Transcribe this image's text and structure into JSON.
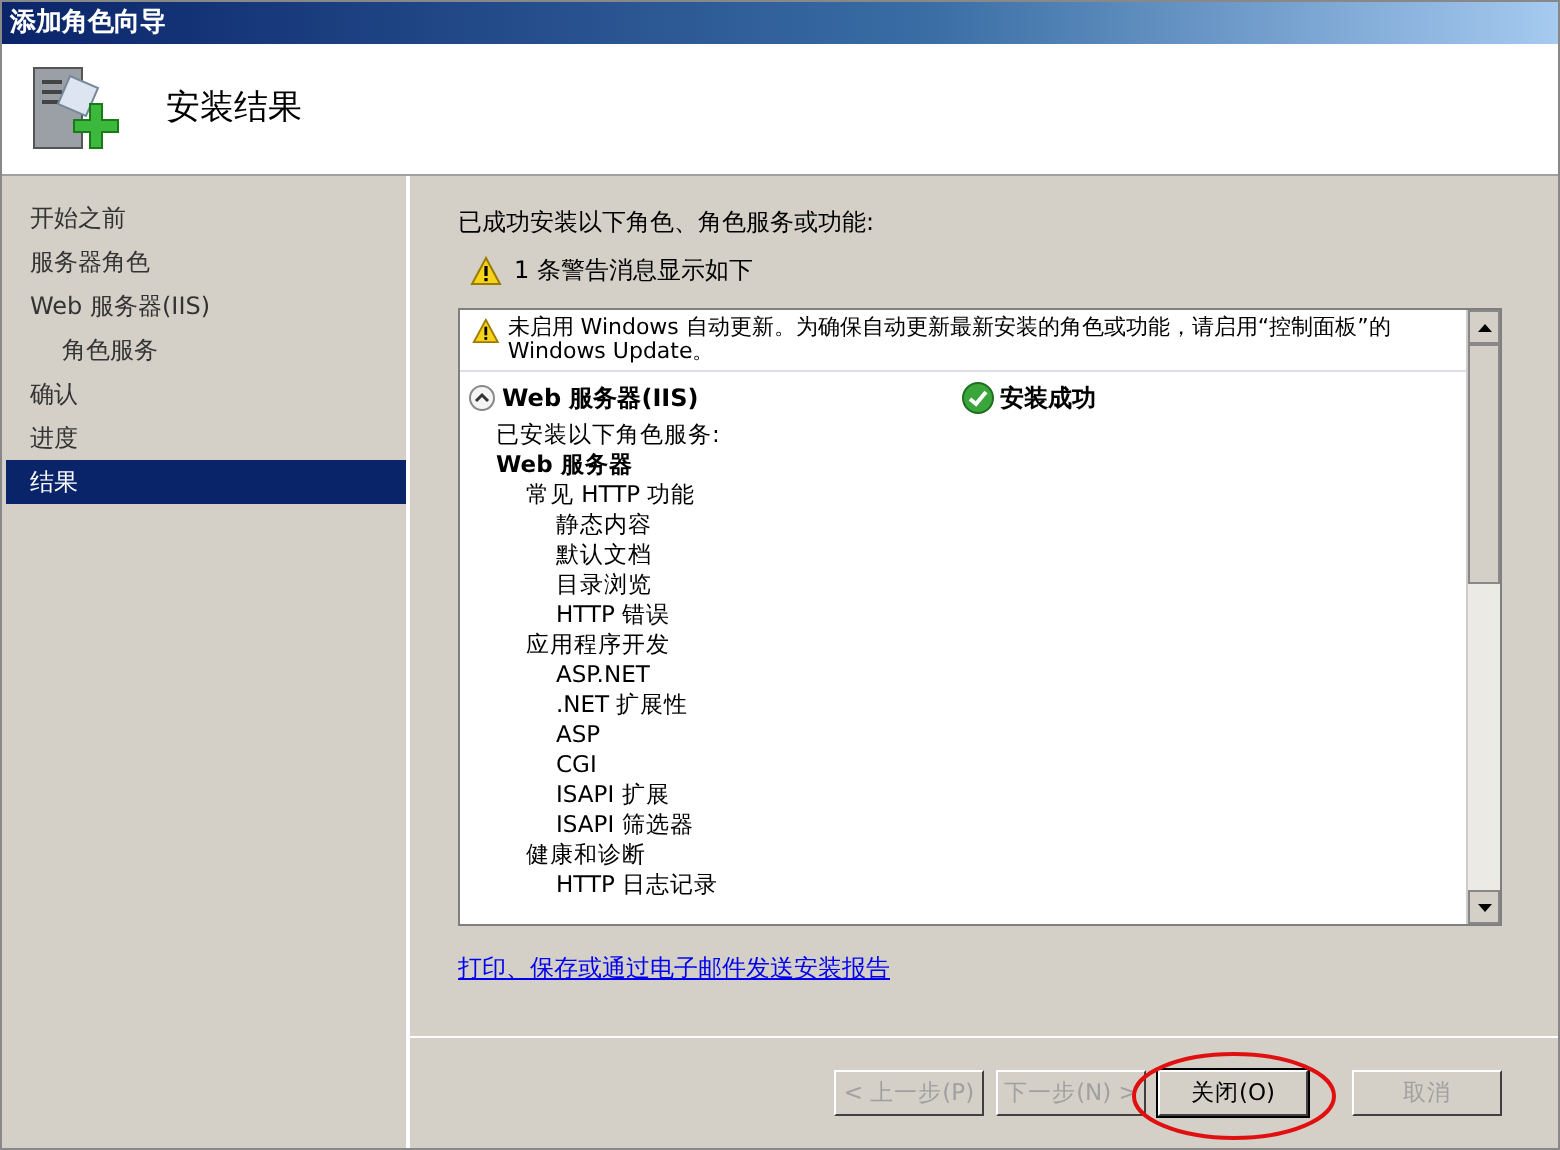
{
  "window": {
    "title": "添加角色向导"
  },
  "header": {
    "title": "安装结果"
  },
  "sidebar": {
    "items": [
      {
        "label": "开始之前",
        "selected": false
      },
      {
        "label": "服务器角色",
        "selected": false
      },
      {
        "label": "Web 服务器(IIS)",
        "selected": false,
        "children": [
          {
            "label": "角色服务",
            "selected": false
          }
        ]
      },
      {
        "label": "确认",
        "selected": false
      },
      {
        "label": "进度",
        "selected": false
      },
      {
        "label": "结果",
        "selected": true
      }
    ]
  },
  "intro": "已成功安装以下角色、角色服务或功能:",
  "warning_summary": "1 条警告消息显示如下",
  "results": {
    "warning": "未启用 Windows 自动更新。为确保自动更新最新安装的角色或功能，请启用“控制面板”的 Windows Update。",
    "role": "Web 服务器(IIS)",
    "expanded": true,
    "status": "安装成功",
    "summary": "已安装以下角色服务:",
    "services": [
      {
        "label": "Web 服务器",
        "children": [
          {
            "label": "常见 HTTP 功能",
            "children": [
              {
                "label": "静态内容"
              },
              {
                "label": "默认文档"
              },
              {
                "label": "目录浏览"
              },
              {
                "label": "HTTP 错误"
              }
            ]
          },
          {
            "label": "应用程序开发",
            "children": [
              {
                "label": "ASP.NET"
              },
              {
                "label": ".NET 扩展性"
              },
              {
                "label": "ASP"
              },
              {
                "label": "CGI"
              },
              {
                "label": "ISAPI 扩展"
              },
              {
                "label": "ISAPI 筛选器"
              }
            ]
          },
          {
            "label": "健康和诊断",
            "children": [
              {
                "label": "HTTP 日志记录"
              }
            ]
          }
        ]
      }
    ]
  },
  "report_link": "打印、保存或通过电子邮件发送安装报告",
  "buttons": [
    {
      "label": "< 上一步(P)",
      "disabled": true,
      "highlighted": false
    },
    {
      "label": "下一步(N) >",
      "disabled": true,
      "highlighted": false
    },
    {
      "label": "关闭(O)",
      "disabled": false,
      "highlighted": true
    },
    {
      "label": "取消",
      "disabled": true,
      "highlighted": false
    }
  ]
}
